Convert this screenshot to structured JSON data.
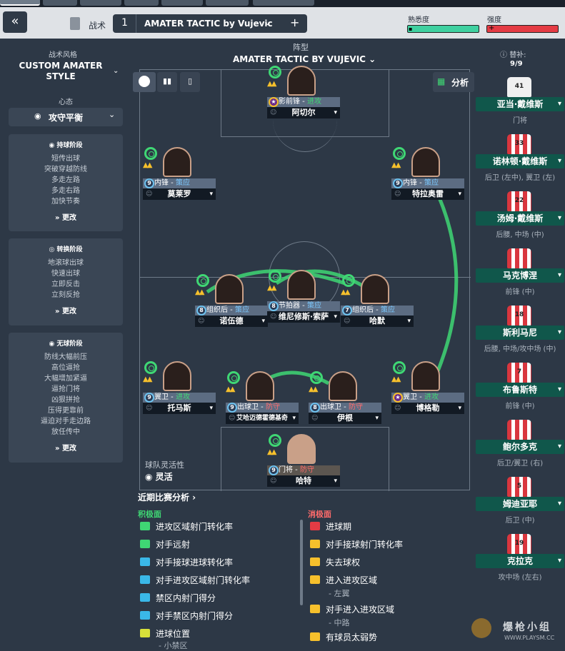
{
  "header": {
    "back_icon": "«",
    "tactic_label": "战术",
    "slot_number": "1",
    "tactic_name": "AMATER TACTIC by Vujevic",
    "add_icon": "+",
    "familiarity_label": "熟悉度",
    "strength_label": "强度",
    "familiarity_fraction": 0.72,
    "strength_fraction": 0.95
  },
  "left": {
    "style_label": "战术风格",
    "style_value": "CUSTOM AMATER STYLE",
    "mentality_label": "心态",
    "mentality_value": "攻守平衡",
    "phases": [
      {
        "title": "持球阶段",
        "items": [
          "短传出球",
          "突破穿越防线",
          "多走左路",
          "多走右路",
          "加快节奏"
        ],
        "change": "更改"
      },
      {
        "title": "转换阶段",
        "items": [
          "地滚球出球",
          "快速出球",
          "立即反击",
          "立刻反抢"
        ],
        "change": "更改"
      },
      {
        "title": "无球阶段",
        "items": [
          "防线大幅前压",
          "高位逼抢",
          "大幅增加紧逼",
          "逼抢门将",
          "凶狠拼抢",
          "压得更靠前",
          "逼迫对手走边路",
          "放任传中"
        ],
        "change": "更改"
      }
    ],
    "flex_label": "球队灵活性",
    "flex_value": "灵活"
  },
  "pitch": {
    "formation_label": "阵型",
    "tactic_title": "AMATER TACTIC BY VUJEVIC",
    "analysis_label": "分析"
  },
  "players": [
    {
      "role": "影前锋",
      "duty": "进攻",
      "duty_class": "duty-g",
      "name": "阿切尔",
      "num": ""
    },
    {
      "role": "内锋",
      "duty": "策应",
      "duty_class": "duty-b",
      "name": "莫莱罗",
      "num": "9"
    },
    {
      "role": "内锋",
      "duty": "策应",
      "duty_class": "duty-b",
      "name": "特拉奥雷",
      "num": "9"
    },
    {
      "role": "组织后",
      "duty": "策应",
      "duty_class": "duty-b",
      "name": "诺伍德",
      "num": "8"
    },
    {
      "role": "节拍器",
      "duty": "策应",
      "duty_class": "duty-b",
      "name": "维尼修斯·索萨",
      "num": "8"
    },
    {
      "role": "组织后",
      "duty": "策应",
      "duty_class": "duty-b",
      "name": "哈默",
      "num": "7"
    },
    {
      "role": "翼卫",
      "duty": "进攻",
      "duty_class": "duty-g",
      "name": "托马斯",
      "num": "9"
    },
    {
      "role": "出球卫",
      "duty": "防守",
      "duty_class": "duty-r",
      "name": "艾哈迈德霍德基奇",
      "num": "9"
    },
    {
      "role": "出球卫",
      "duty": "防守",
      "duty_class": "duty-r",
      "name": "伊根",
      "num": "8"
    },
    {
      "role": "翼卫",
      "duty": "进攻",
      "duty_class": "duty-g",
      "name": "博格勒",
      "num": ""
    },
    {
      "role": "门将",
      "duty": "防守",
      "duty_class": "duty-r",
      "name": "哈特",
      "num": "9"
    }
  ],
  "subs": {
    "label": "替补:",
    "count": "9/9",
    "list": [
      {
        "num": "41",
        "name": "亚当·戴维斯",
        "pos": "门将"
      },
      {
        "num": "33",
        "name": "诺林顿·戴维斯",
        "pos": "后卫 (左中), 翼卫 (左)"
      },
      {
        "num": "22",
        "name": "汤姆·戴维斯",
        "pos": "后腰, 中场 (中)"
      },
      {
        "num": "",
        "name": "马克博涅",
        "pos": "前锋 (中)"
      },
      {
        "num": "18",
        "name": "斯利马尼",
        "pos": "后腰, 中场/攻中场 (中)"
      },
      {
        "num": "7",
        "name": "布鲁斯特",
        "pos": "前锋 (中)"
      },
      {
        "num": "",
        "name": "鲍尔多克",
        "pos": "后卫/翼卫 (右)"
      },
      {
        "num": "5",
        "name": "姆迪亚耶",
        "pos": "后卫 (中)"
      },
      {
        "num": "19",
        "name": "克拉克",
        "pos": "攻中场 (左右)"
      }
    ]
  },
  "analysis": {
    "title": "近期比赛分析 ›",
    "pos_label": "积极面",
    "neg_label": "消极面",
    "positives": [
      "进攻区域射门转化率",
      "对手远射",
      "对手接球进球转化率",
      "对手进攻区域射门转化率",
      "禁区内射门得分",
      "对手禁区内射门得分",
      "进球位置"
    ],
    "pos_sub": "- 小禁区",
    "negatives": [
      "进球期",
      "对手接球射门转化率",
      "失去球权",
      "进入进攻区域",
      "对手进入进攻区域",
      "有球员太弱势"
    ],
    "neg_sub1": "- 左翼",
    "neg_sub2": "- 中路"
  },
  "watermark": "爆枪小组",
  "watermark_url": "WWW.PLAYSM.CC",
  "colors": {
    "accent": "#3fd774",
    "sub_green": "#10574b",
    "shirt_red": "#d9363e"
  }
}
